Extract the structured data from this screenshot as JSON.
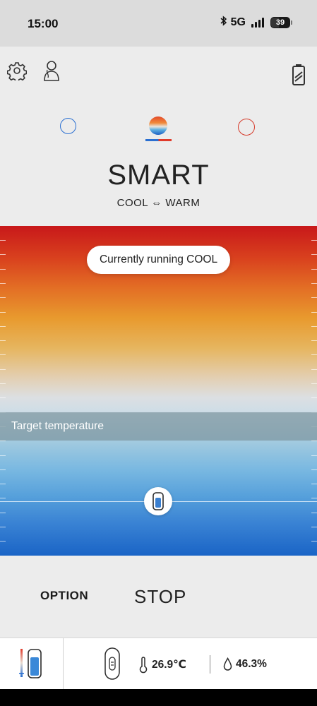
{
  "status_bar": {
    "time": "15:00",
    "network": "5G",
    "battery_level": "39",
    "icons": [
      "bluetooth-icon",
      "signal-icon",
      "battery-icon"
    ]
  },
  "header": {
    "icons": [
      "gear-icon",
      "person-icon",
      "device-battery-icon"
    ]
  },
  "modes": {
    "items": [
      "cool",
      "smart",
      "warm"
    ],
    "selected": "smart"
  },
  "mode_title": "SMART",
  "mode_subtitle": "COOL ⇔ WARM",
  "panel": {
    "running_status": "Currently running COOL",
    "target_label": "Target temperature"
  },
  "actions": {
    "option_label": "OPTION",
    "stop_label": "STOP"
  },
  "bottom_bar": {
    "temperature": "26.9℃",
    "humidity": "46.3%"
  },
  "colors": {
    "cool": "#2a6fd1",
    "warm": "#d63b2b",
    "panel_top": "#c8181a",
    "panel_bottom": "#1a64c6"
  }
}
